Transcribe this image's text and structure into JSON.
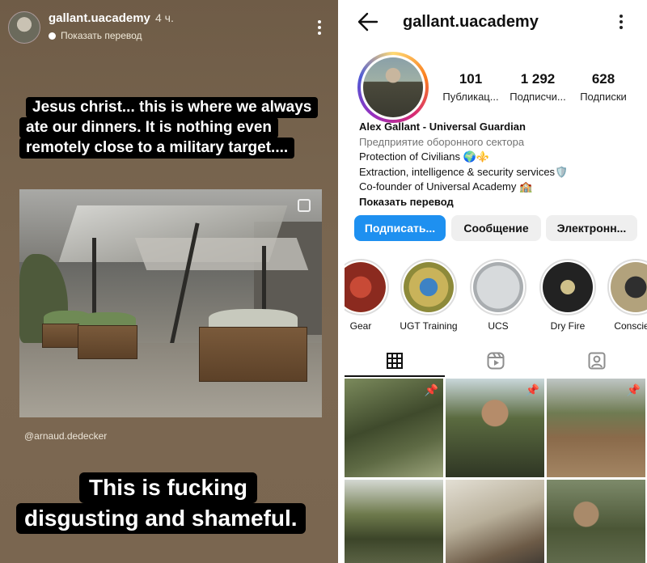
{
  "story": {
    "username": "gallant.uacademy",
    "time": "4 ч.",
    "translate_label": "Показать перевод",
    "caption_top": [
      "Jesus christ... this is where we always",
      "ate our dinners. It is nothing even",
      "remotely close to a military target...."
    ],
    "credit": "@arnaud.dedecker",
    "caption_bottom": [
      "This is fucking",
      "disgusting and shameful."
    ]
  },
  "profile": {
    "username": "gallant.uacademy",
    "stats": [
      {
        "value": "101",
        "label": "Публикац..."
      },
      {
        "value": "1 292",
        "label": "Подписчи..."
      },
      {
        "value": "628",
        "label": "Подписки"
      }
    ],
    "bio": {
      "name": "Alex Gallant - Universal Guardian",
      "category": "Предприятие оборонного сектора",
      "line1": "Protection of Civilians 🌍⚜️",
      "line2": "Extraction, intelligence & security services🛡️",
      "line3": "Co-founder of Universal Academy 🏫",
      "translate": "Показать перевод"
    },
    "buttons": {
      "follow": "Подписать...",
      "message": "Сообщение",
      "email": "Электронн..."
    },
    "highlights": [
      {
        "label": "Gear",
        "color": "#8b2a1f",
        "accent": "#d8b267"
      },
      {
        "label": "UGT Training",
        "color": "#8d8a3a",
        "accent": "#3d82c4"
      },
      {
        "label": "UCS",
        "color": "#c9ccce",
        "accent": "#222222"
      },
      {
        "label": "Dry Fire",
        "color": "#222222",
        "accent": "#cfc08a"
      },
      {
        "label": "Conscient",
        "color": "#b2a27c",
        "accent": "#2f2f2f"
      }
    ],
    "tabs": [
      "grid-icon",
      "reels-icon",
      "tagged-icon"
    ],
    "accent_color": "#1e90f0"
  }
}
